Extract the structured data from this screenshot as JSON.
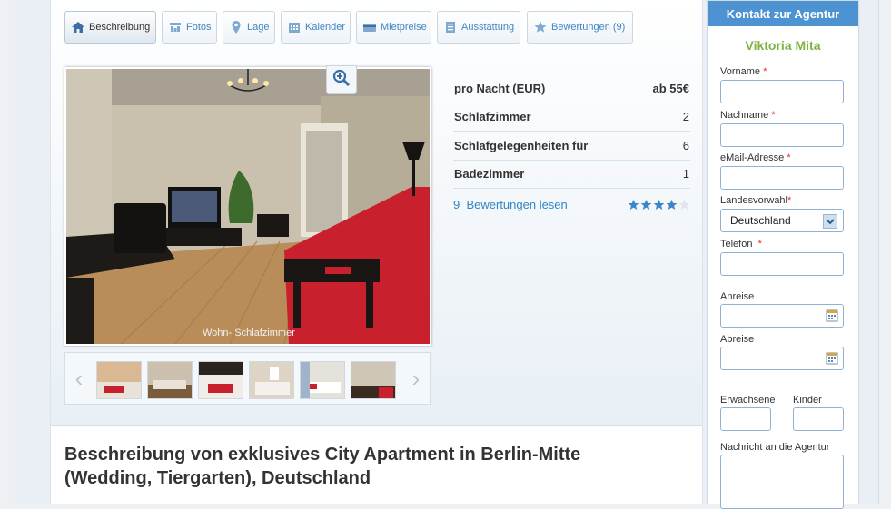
{
  "tabs": [
    {
      "label": "Beschreibung",
      "icon": "house-icon"
    },
    {
      "label": "Fotos",
      "icon": "gallery-icon"
    },
    {
      "label": "Lage",
      "icon": "map-pin-icon"
    },
    {
      "label": "Kalender",
      "icon": "calendar-icon"
    },
    {
      "label": "Mietpreise",
      "icon": "credit-card-icon"
    },
    {
      "label": "Ausstattung",
      "icon": "list-icon"
    },
    {
      "label": "Bewertungen (9)",
      "icon": "star-icon"
    }
  ],
  "photo": {
    "caption": "Wohn- Schlafzimmer",
    "zoom_icon": "magnifier-plus-icon"
  },
  "thumbnails": {
    "count": 6,
    "prev_icon": "chevron-left-icon",
    "next_icon": "chevron-right-icon"
  },
  "facts": [
    {
      "label": "pro Nacht (EUR)",
      "value": "ab 55€"
    },
    {
      "label": "Schlafzimmer",
      "value": "2"
    },
    {
      "label": "Schlafgelegenheiten für",
      "value": "6"
    },
    {
      "label": "Badezimmer",
      "value": "1"
    }
  ],
  "reviews": {
    "count": "9",
    "link": "Bewertungen lesen",
    "rating": 4,
    "max": 5
  },
  "description_title": "Beschreibung von exklusives City Apartment in Berlin-Mitte (Wedding, Tiergarten), Deutschland",
  "contact": {
    "header": "Kontakt zur Agentur",
    "agent": "Viktoria Mita",
    "fields": {
      "vorname": "Vorname",
      "nachname": "Nachname",
      "email": "eMail-Adresse",
      "landesvorwahl": "Landesvorwahl",
      "landesvorwahl_value": "Deutschland",
      "telefon": "Telefon",
      "anreise": "Anreise",
      "abreise": "Abreise",
      "erwachsene": "Erwachsene",
      "kinder": "Kinder",
      "nachricht": "Nachricht an die Agentur"
    },
    "required_mark": "*"
  },
  "colors": {
    "link": "#2f86c8",
    "header": "#4d93d1",
    "agent": "#7cb342",
    "sofa": "#c8202c"
  }
}
